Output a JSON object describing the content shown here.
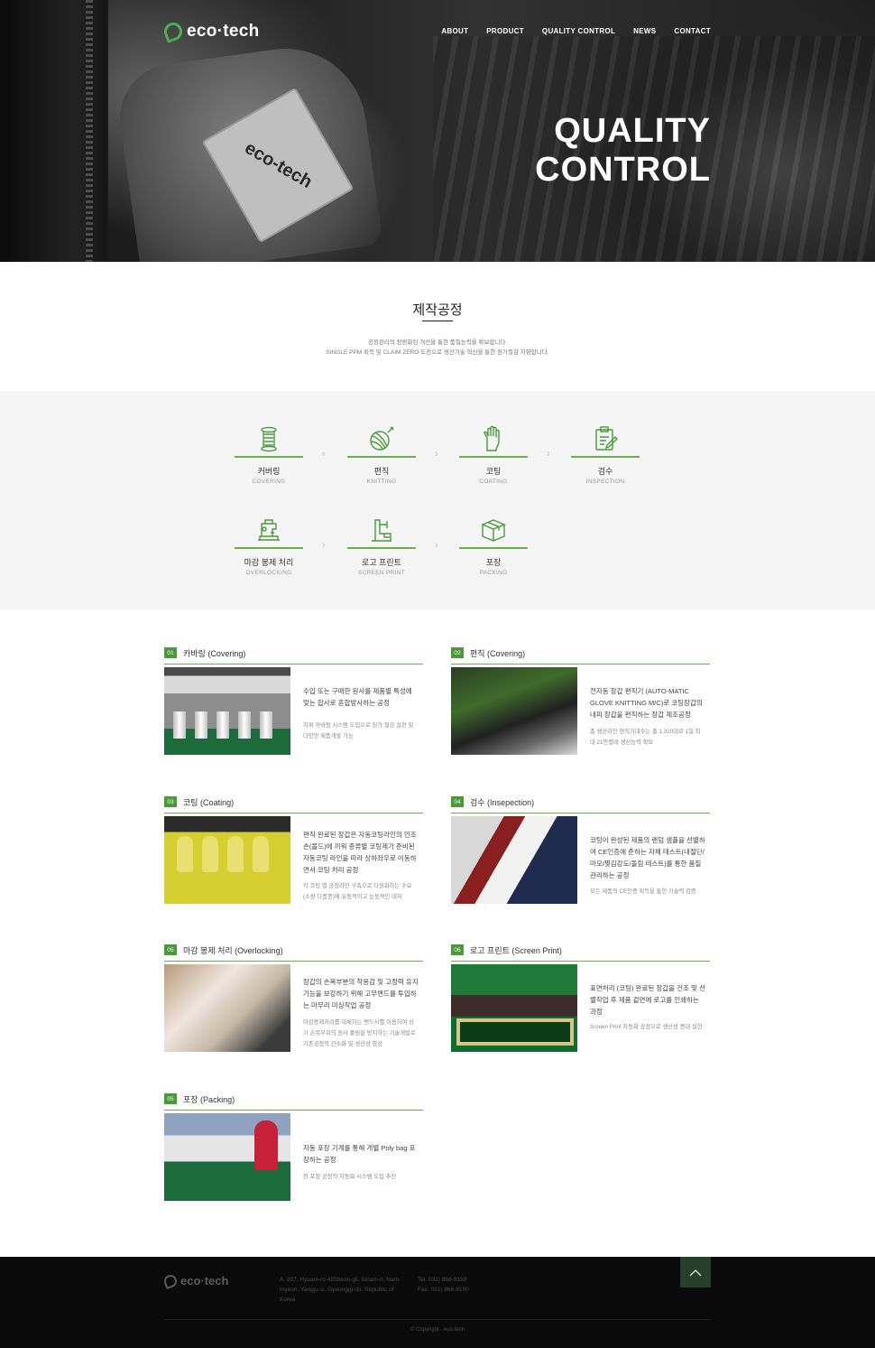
{
  "header": {
    "logo_text": "eco·tech",
    "nav": [
      "ABOUT",
      "PRODUCT",
      "QUALITY CONTROL",
      "NEWS",
      "CONTACT"
    ],
    "hero_title_line1": "QUALITY",
    "hero_title_line2": "CONTROL",
    "tag_text": "eco-tech"
  },
  "intro": {
    "title": "제작공정",
    "line1": "공정관리의 정량화된 개선을 통한 품질능력을 확보합니다.",
    "line2": "SINGLE PPM 획득 및 CLAIM ZERO 도전으로 생산기술 혁신을 통한 원가절감 지향합니다."
  },
  "process": {
    "steps": [
      {
        "ko": "커버링",
        "en": "COVERING",
        "icon": "thread-spool-icon"
      },
      {
        "ko": "편직",
        "en": "KNITTING",
        "icon": "yarn-ball-icon"
      },
      {
        "ko": "코팅",
        "en": "COATING",
        "icon": "glove-icon"
      },
      {
        "ko": "검수",
        "en": "INSPECTION",
        "icon": "clipboard-check-icon"
      },
      {
        "ko": "마감 봉제 처리",
        "en": "OVERLOCKING",
        "icon": "sewing-machine-icon"
      },
      {
        "ko": "로고 프린트",
        "en": "SCREEN PRINT",
        "icon": "print-machine-icon"
      },
      {
        "ko": "포장",
        "en": "PACKING",
        "icon": "box-icon"
      }
    ],
    "arrow": "›"
  },
  "items": [
    {
      "num": "01",
      "title": "카바링 (Covering)",
      "desc": "수입 또는 구매한 원사를 제품별 특성에 맞는 합사로 혼합방사하는 공정",
      "sub": "지퍼 카바링 시스템 도입으로 원가 절감 실현 및 다양한 제품개발 가능"
    },
    {
      "num": "02",
      "title": "편직 (Covering)",
      "desc": "전자동 장갑 편직기 (AUTO-MATIC GLOVE KNITTING M/C)로 코팅장갑의 내피 장갑을 편직하는 장갑 제조공정",
      "sub": "총 생산라인 편직기대수는 총 1,320대로 1일 최대 21만켤레 생산능력 확보"
    },
    {
      "num": "03",
      "title": "코팅 (Coating)",
      "desc": "편직 완료된 장갑은 자동코팅라인의 인조 손(몰드)에 끼워 종류별 코팅제가 준비된 자동코팅 라인을 따라 상하좌우로 이동하면서 코팅 처리 공정",
      "sub": "각 코팅 별 공정라인 구축으로 다원화하는 수요(소량 다품종)에 유동적이고 능동적인 대처"
    },
    {
      "num": "04",
      "title": "검수 (Insepection)",
      "desc": "코팅이 완성된 제품의 랜덤 샘플을 선별하여 CE인증에 준하는 자체 테스트(내절단/마모/찢김강도/돌림 테스트)를 통한 품질 관리하는 공정",
      "sub": "모든 제품의 CE인증 획득을 통한 기술력 검증"
    },
    {
      "num": "05",
      "title": "마감 봉제 처리 (Overlocking)",
      "desc": "장갑의 손목부분의 착용감 및 고정력 유지 기능을 보강하기 위해 고무밴드를 투입하는 마무리 미싱작업 공정",
      "sub": "마감봉제처리를 대체하는 밴드사를 이용하여 상기 손목부위의 원사 풀림을 방지하는 기술개발로 기존공정의 간소화 및 생산성 향상"
    },
    {
      "num": "06",
      "title": "로고 프린트 (Screen Print)",
      "desc": "표면처리 (코팅) 완료된 장갑을 건조 및 선별작업 후 제품 겉면에 로고를 인쇄하는 과정",
      "sub": "Screen Print 자동화 공정으로 생산성 증대 실현"
    },
    {
      "num": "05",
      "title": "포장 (Packing)",
      "desc": "자동 포장 기계를 통해 개별 Poly bag 포장하는 공정",
      "sub": "전 포장 공정의 자동화 시스템 도입 추진"
    }
  ],
  "footer": {
    "logo_text": "eco·tech",
    "address": "A. 207, Hyuam-ro 455beon-gil, Sinam-ri, Nam-myeon, Yangju-si, Gyeonggi-do, Republic of Korea",
    "tel": "Tel. 031) 868-8189",
    "fax": "Fax. 031) 868-8190",
    "copyright": "© Copyright - eco-tech",
    "top_icon": "chevron-up-icon"
  }
}
